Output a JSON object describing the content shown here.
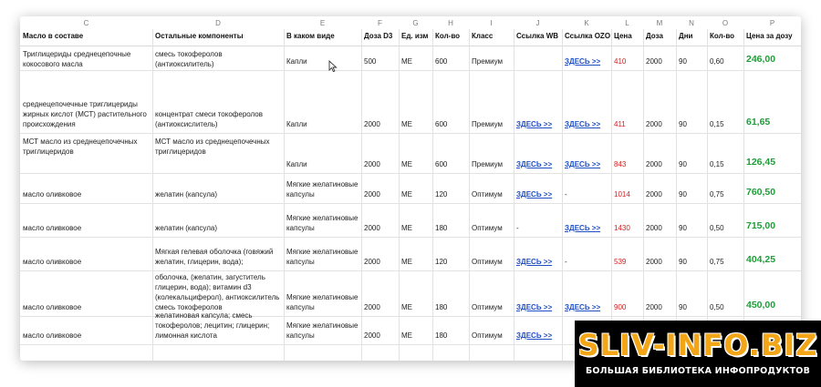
{
  "column_letters": [
    "C",
    "D",
    "E",
    "F",
    "G",
    "H",
    "I",
    "J",
    "K",
    "L",
    "M",
    "N",
    "O",
    "P"
  ],
  "headers": [
    "Масло в составе",
    "Остальные компоненты",
    "В каком виде",
    "Доза D3",
    "Ед. изм",
    "Кол-во",
    "Класс",
    "Ссылка WB",
    "Ссылка OZON",
    "Цена",
    "Доза",
    "Дни",
    "Кол-во",
    "Цена за дозу"
  ],
  "rows": [
    {
      "oil": "Триглицериды среднецепочные\nкокосового масла",
      "components": "смесь токоферолов (антиоксилитель)",
      "form": "Капли",
      "d3": "500",
      "unit": "МЕ",
      "qty": "600",
      "class": "Премиум",
      "wb": "",
      "ozon": "ЗДЕСЬ >>",
      "price": "410",
      "dose": "2000",
      "days": "90",
      "count": "0,60",
      "per_dose": "246,00"
    },
    {
      "oil": "среднецепочечные триглицериды\nжирных кислот (МСТ) растительного\nпроисхождения",
      "components": "концентрат смеси токоферолов\n(антиоксислитель)",
      "form": "Капли",
      "d3": "2000",
      "unit": "МЕ",
      "qty": "600",
      "class": "Премиум",
      "wb": "ЗДЕСЬ >>",
      "ozon": "ЗДЕСЬ >>",
      "price": "411",
      "dose": "2000",
      "days": "90",
      "count": "0,15",
      "per_dose": "61,65"
    },
    {
      "oil": "МСТ масло из среднецепочечных\nтриглицеридов",
      "components": "МСТ масло из среднецепочечных\nтриглицеридов",
      "form": "Капли",
      "d3": "2000",
      "unit": "МЕ",
      "qty": "600",
      "class": "Премиум",
      "wb": "ЗДЕСЬ >>",
      "ozon": "ЗДЕСЬ >>",
      "price": "843",
      "dose": "2000",
      "days": "90",
      "count": "0,15",
      "per_dose": "126,45"
    },
    {
      "oil": "масло оливковое",
      "components": "желатин (капсула)",
      "form": "Мягкие желатиновые\nкапсулы",
      "d3": "2000",
      "unit": "МЕ",
      "qty": "120",
      "class": "Оптимум",
      "wb": "ЗДЕСЬ >>",
      "ozon": "-",
      "price": "1014",
      "dose": "2000",
      "days": "90",
      "count": "0,75",
      "per_dose": "760,50"
    },
    {
      "oil": "масло оливковое",
      "components": "желатин (капсула)",
      "form": "Мягкие желатиновые\nкапсулы",
      "d3": "2000",
      "unit": "МЕ",
      "qty": "180",
      "class": "Оптимум",
      "wb": "-",
      "ozon": "ЗДЕСЬ >>",
      "price": "1430",
      "dose": "2000",
      "days": "90",
      "count": "0,50",
      "per_dose": "715,00"
    },
    {
      "oil": "масло оливковое",
      "components": "Мягкая гелевая оболочка (говяжий\nжелатин, глицерин, вода);",
      "form": "Мягкие желатиновые\nкапсулы",
      "d3": "2000",
      "unit": "МЕ",
      "qty": "120",
      "class": "Оптимум",
      "wb": "ЗДЕСЬ >>",
      "ozon": "-",
      "price": "539",
      "dose": "2000",
      "days": "90",
      "count": "0,75",
      "per_dose": "404,25"
    },
    {
      "oil": "масло оливковое",
      "components": "оболочка, (желатин, загуститель\nглицерин, вода); витамин d3\n(колекальциферол), антиоксилитель\nсмесь токоферолов",
      "form": "Мягкие желатиновые\nкапсулы",
      "d3": "2000",
      "unit": "МЕ",
      "qty": "180",
      "class": "Оптимум",
      "wb": "ЗДЕСЬ >>",
      "ozon": "ЗДЕСЬ >>",
      "price": "900",
      "dose": "2000",
      "days": "90",
      "count": "0,50",
      "per_dose": "450,00"
    },
    {
      "oil": "масло оливковое",
      "components": "желатиновая капсула; смесь\nтокоферолов; лецитин; глицерин;\nлимонная кислота",
      "form": "Мягкие желатиновые\nкапсулы",
      "d3": "2000",
      "unit": "МЕ",
      "qty": "180",
      "class": "Оптимум",
      "wb": "ЗДЕСЬ >>",
      "ozon": "",
      "price": "",
      "dose": "",
      "days": "",
      "count": "",
      "per_dose": ""
    }
  ],
  "watermark": {
    "title": "SLIV-INFO.BIZ",
    "subtitle": "БОЛЬШАЯ БИБЛИОТЕКА ИНФОПРОДУКТОВ"
  },
  "colors": {
    "link": "#1f4fc4",
    "price": "#d42020",
    "dose_price": "#1f9d38",
    "watermark_title": "#f2a516"
  }
}
